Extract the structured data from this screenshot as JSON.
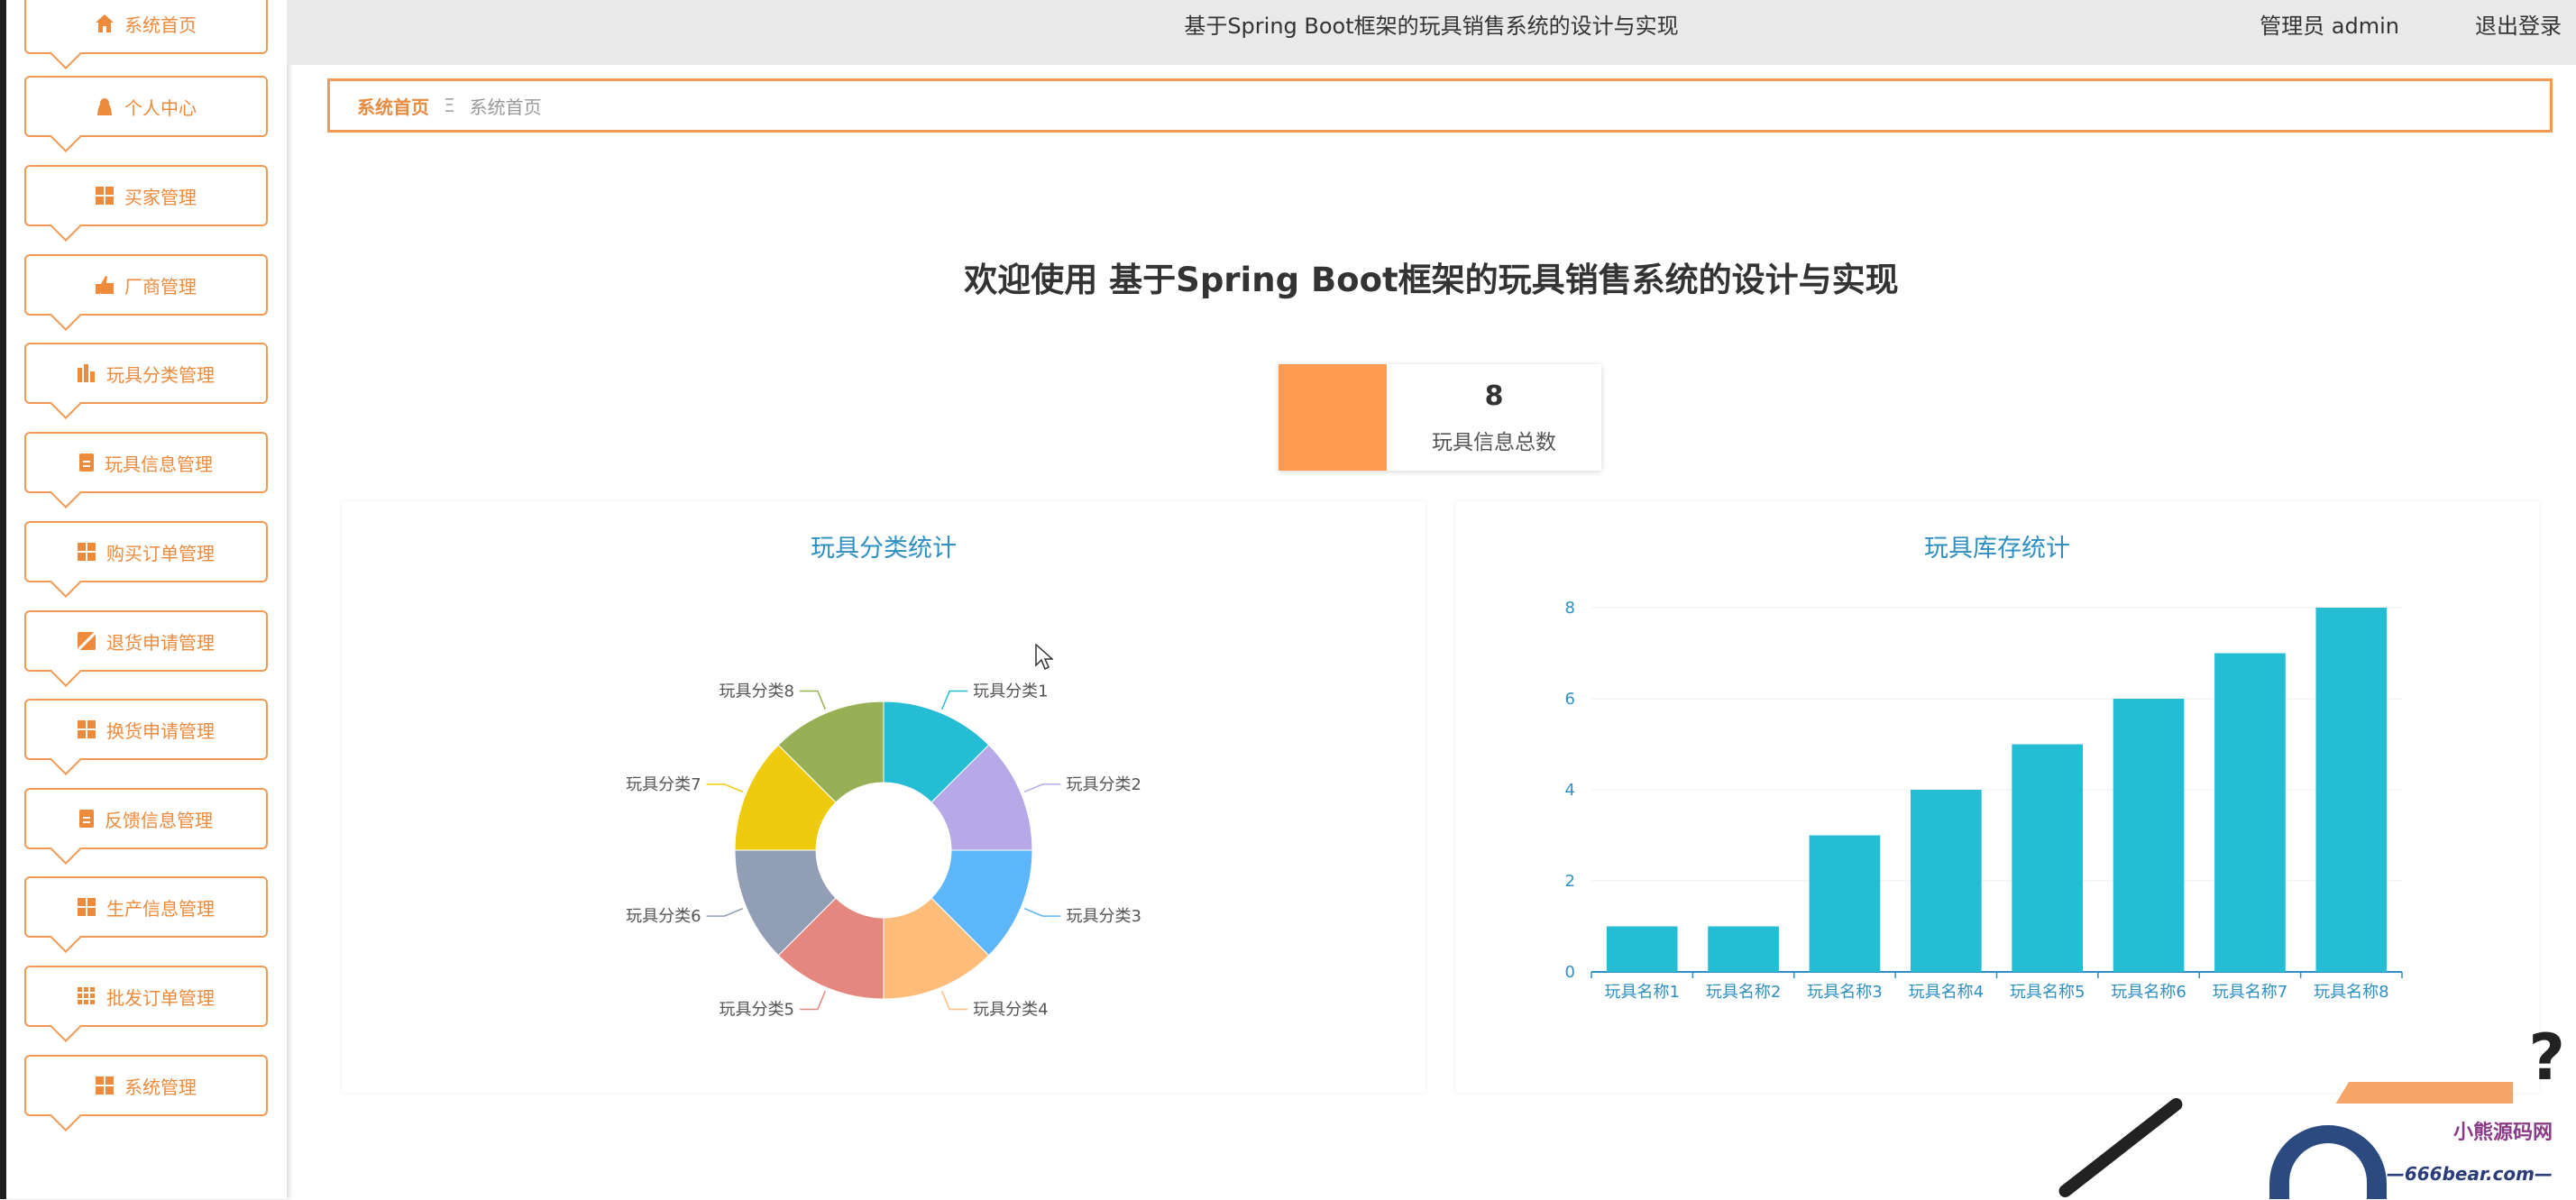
{
  "header": {
    "title": "基于Spring Boot框架的玩具销售系统的设计与实现",
    "user_label": "管理员 admin",
    "logout_label": "退出登录"
  },
  "sidebar": {
    "items": [
      {
        "label": "系统首页",
        "icon": "home-icon"
      },
      {
        "label": "个人中心",
        "icon": "user-icon"
      },
      {
        "label": "买家管理",
        "icon": "grid-icon"
      },
      {
        "label": "厂商管理",
        "icon": "thumb-icon"
      },
      {
        "label": "玩具分类管理",
        "icon": "bars-icon"
      },
      {
        "label": "玩具信息管理",
        "icon": "clipboard-icon"
      },
      {
        "label": "购买订单管理",
        "icon": "grid-icon"
      },
      {
        "label": "退货申请管理",
        "icon": "chart-icon"
      },
      {
        "label": "换货申请管理",
        "icon": "grid-icon"
      },
      {
        "label": "反馈信息管理",
        "icon": "clipboard-icon"
      },
      {
        "label": "生产信息管理",
        "icon": "grid-icon"
      },
      {
        "label": "批发订单管理",
        "icon": "grid9-icon"
      },
      {
        "label": "系统管理",
        "icon": "grid-icon"
      }
    ]
  },
  "breadcrumb": {
    "home": "系统首页",
    "separator": "Ξ",
    "current": "系统首页"
  },
  "welcome": "欢迎使用 基于Spring Boot框架的玩具销售系统的设计与实现",
  "stat": {
    "value": "8",
    "label": "玩具信息总数",
    "color": "#ff9a50"
  },
  "charts": {
    "left_title": "玩具分类统计",
    "right_title": "玩具库存统计"
  },
  "chart_data": [
    {
      "type": "pie",
      "title": "玩具分类统计",
      "donut": true,
      "labels": [
        "玩具分类1",
        "玩具分类2",
        "玩具分类3",
        "玩具分类4",
        "玩具分类5",
        "玩具分类6",
        "玩具分类7",
        "玩具分类8"
      ],
      "values": [
        1,
        1,
        1,
        1,
        1,
        1,
        1,
        1
      ],
      "colors": [
        "#24bdd3",
        "#b7a9e8",
        "#5cb6f9",
        "#fdbd78",
        "#e5877e",
        "#919eb6",
        "#eecb0e",
        "#98b055"
      ]
    },
    {
      "type": "bar",
      "title": "玩具库存统计",
      "categories": [
        "玩具名称1",
        "玩具名称2",
        "玩具名称3",
        "玩具名称4",
        "玩具名称5",
        "玩具名称6",
        "玩具名称7",
        "玩具名称8"
      ],
      "values": [
        1,
        1,
        3,
        4,
        5,
        6,
        7,
        8
      ],
      "ylim": [
        0,
        8
      ],
      "yticks": [
        "0",
        "2",
        "4",
        "6",
        "8"
      ],
      "color": "#24bdd3",
      "grid": true
    }
  ],
  "watermark": {
    "line1": "小熊源码网",
    "line2": "—666bear.com—"
  },
  "colors": {
    "accent": "#f29a55",
    "title_blue": "#2e8fc2"
  }
}
